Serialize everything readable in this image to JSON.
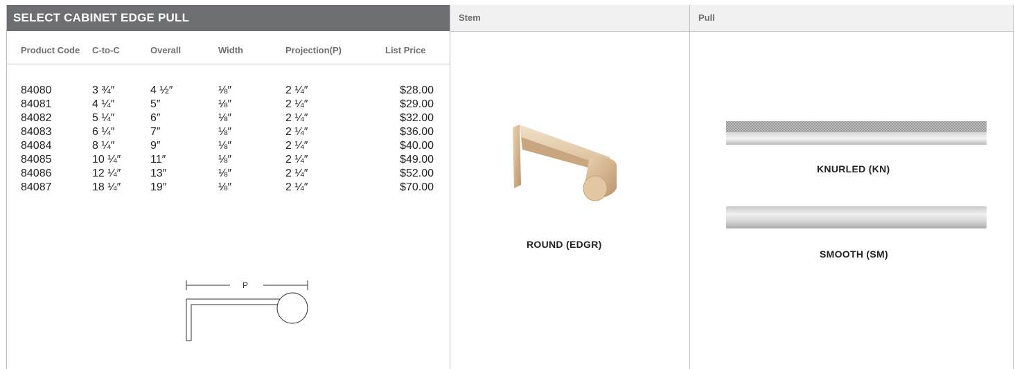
{
  "left": {
    "title": "SELECT CABINET EDGE PULL",
    "columns": [
      "Product Code",
      "C-to-C",
      "Overall",
      "Width",
      "Projection(P)",
      "List Price"
    ],
    "rows": [
      [
        "84080",
        "3 ¾″",
        "4 ½″",
        "⅛″",
        "2 ¼″",
        "$28.00"
      ],
      [
        "84081",
        "4 ¼″",
        "5″",
        "⅛″",
        "2 ¼″",
        "$29.00"
      ],
      [
        "84082",
        "5 ¼″",
        "6″",
        "⅛″",
        "2 ¼″",
        "$32.00"
      ],
      [
        "84083",
        "6 ¼″",
        "7″",
        "⅛″",
        "2 ¼″",
        "$36.00"
      ],
      [
        "84084",
        "8 ¼″",
        "9″",
        "⅛″",
        "2 ¼″",
        "$40.00"
      ],
      [
        "84085",
        "10 ¼″",
        "11″",
        "⅛″",
        "2 ¼″",
        "$49.00"
      ],
      [
        "84086",
        "12 ¼″",
        "13″",
        "⅛″",
        "2 ¼″",
        "$52.00"
      ],
      [
        "84087",
        "18 ¼″",
        "19″",
        "⅛″",
        "2 ¼″",
        "$70.00"
      ]
    ],
    "diagram_label": "P"
  },
  "stem": {
    "header": "Stem",
    "caption": "ROUND (EDGR)"
  },
  "pull": {
    "header": "Pull",
    "options": [
      "KNURLED (KN)",
      "SMOOTH (SM)"
    ]
  },
  "colors": {
    "header_dark": "#6d6e71",
    "header_light": "#f1f1f2",
    "stem_finish": "#d8b993"
  }
}
